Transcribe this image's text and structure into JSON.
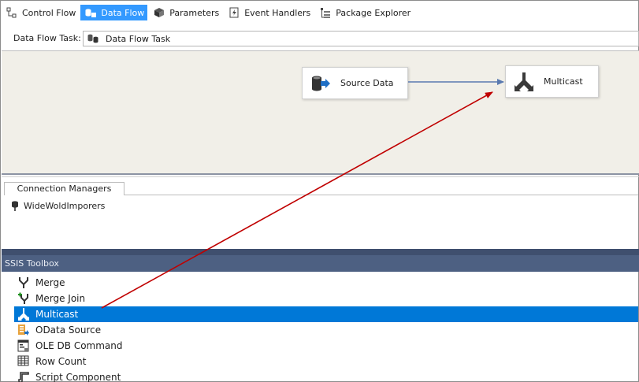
{
  "designer_tabs": [
    {
      "label": "Control Flow",
      "icon": "control-flow-icon",
      "active": false
    },
    {
      "label": "Data Flow",
      "icon": "data-flow-icon",
      "active": true
    },
    {
      "label": "Parameters",
      "icon": "parameters-icon",
      "active": false
    },
    {
      "label": "Event Handlers",
      "icon": "event-handlers-icon",
      "active": false
    },
    {
      "label": "Package Explorer",
      "icon": "package-explorer-icon",
      "active": false
    }
  ],
  "task_selector": {
    "label": "Data Flow Task:",
    "value": "Data Flow Task"
  },
  "surface": {
    "components": [
      {
        "name": "Source Data",
        "icon": "source-icon"
      },
      {
        "name": "Multicast",
        "icon": "multicast-icon"
      }
    ]
  },
  "connection_managers": {
    "tab_label": "Connection Managers",
    "items": [
      "WideWoldImporers"
    ]
  },
  "toolbox": {
    "title": "SSIS Toolbox",
    "items": [
      {
        "label": "Merge",
        "icon": "merge-icon",
        "selected": false
      },
      {
        "label": "Merge Join",
        "icon": "merge-join-icon",
        "selected": false
      },
      {
        "label": "Multicast",
        "icon": "multicast-icon",
        "selected": true
      },
      {
        "label": "OData Source",
        "icon": "odata-source-icon",
        "selected": false
      },
      {
        "label": "OLE DB Command",
        "icon": "ole-db-command-icon",
        "selected": false
      },
      {
        "label": "Row Count",
        "icon": "row-count-icon",
        "selected": false
      },
      {
        "label": "Script Component",
        "icon": "script-component-icon",
        "selected": false
      }
    ]
  },
  "colors": {
    "active_tab": "#3399ff",
    "selection": "#0078d7",
    "toolbox_header": "#4d6082",
    "surface": "#f1efe8",
    "drag_arrow": "#c00000",
    "path_arrow": "#5a7ab0"
  }
}
